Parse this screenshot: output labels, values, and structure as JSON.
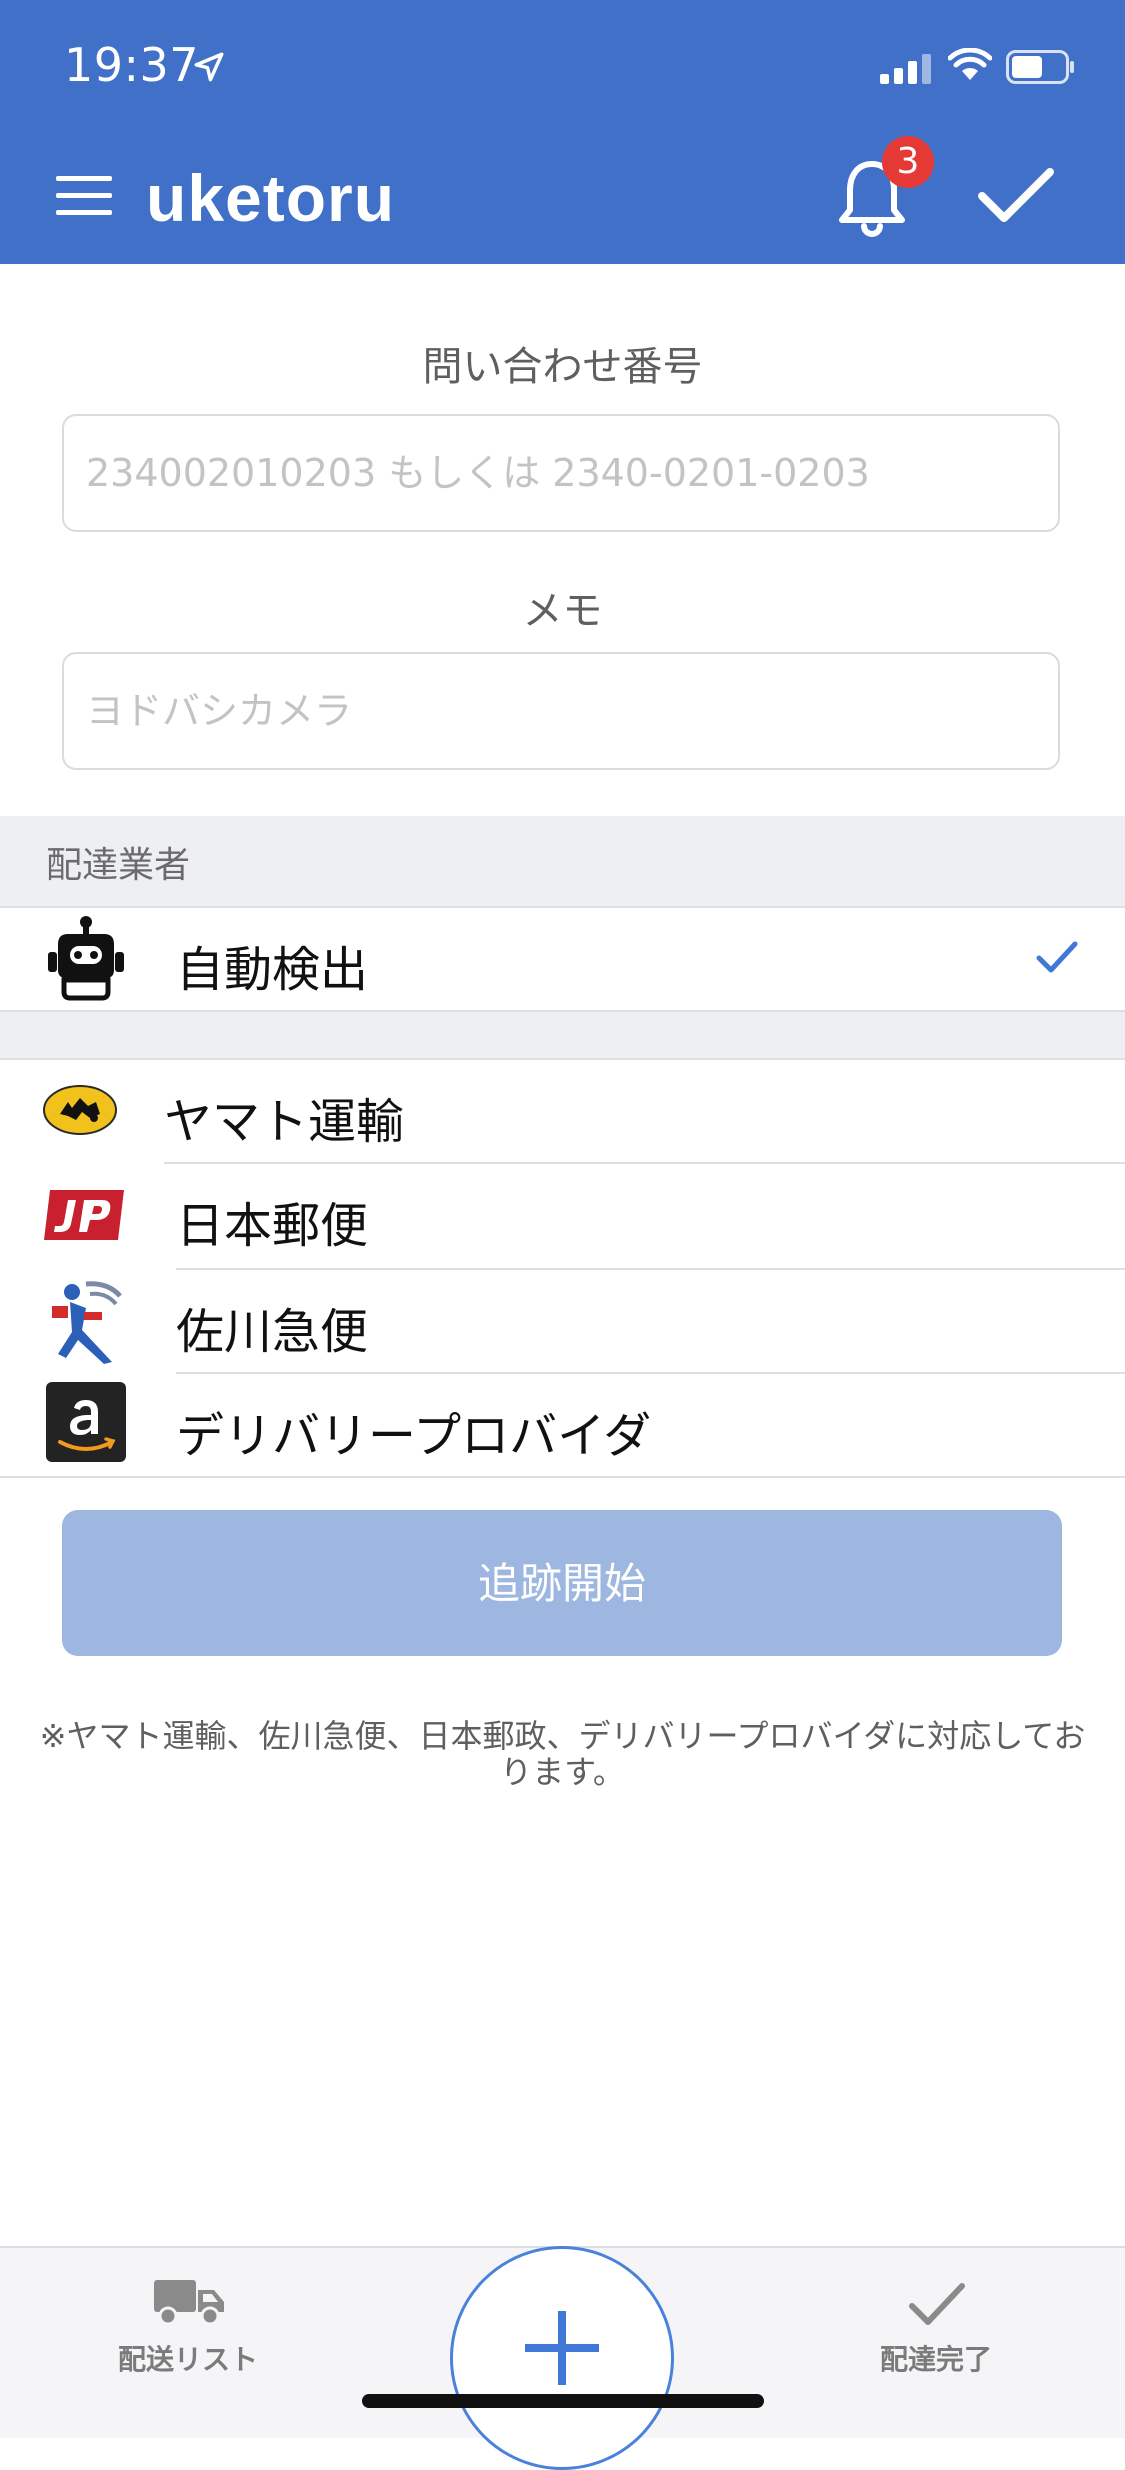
{
  "status_bar": {
    "time": "19:37"
  },
  "header": {
    "brand": "uketoru",
    "notification_count": "3"
  },
  "form": {
    "tracking_label": "問い合わせ番号",
    "tracking_placeholder": "234002010203 もしくは 2340-0201-0203",
    "tracking_value": "",
    "memo_label": "メモ",
    "memo_placeholder": "ヨドバシカメラ",
    "memo_value": ""
  },
  "carriers": {
    "section_title": "配達業者",
    "auto_detect": {
      "label": "自動検出",
      "selected": true
    },
    "items": [
      {
        "label": "ヤマト運輸"
      },
      {
        "label": "日本郵便"
      },
      {
        "label": "佐川急便"
      },
      {
        "label": "デリバリープロバイダ"
      }
    ]
  },
  "actions": {
    "start_tracking": "追跡開始"
  },
  "note": "※ヤマト運輸、佐川急便、日本郵政、デリバリープロバイダに対応しております。",
  "tabbar": {
    "left_label": "配送リスト",
    "right_label": "配達完了"
  },
  "colors": {
    "header": "#4070c7",
    "accent": "#4a82db",
    "button_disabled": "#9db7e0",
    "badge": "#e53935"
  }
}
